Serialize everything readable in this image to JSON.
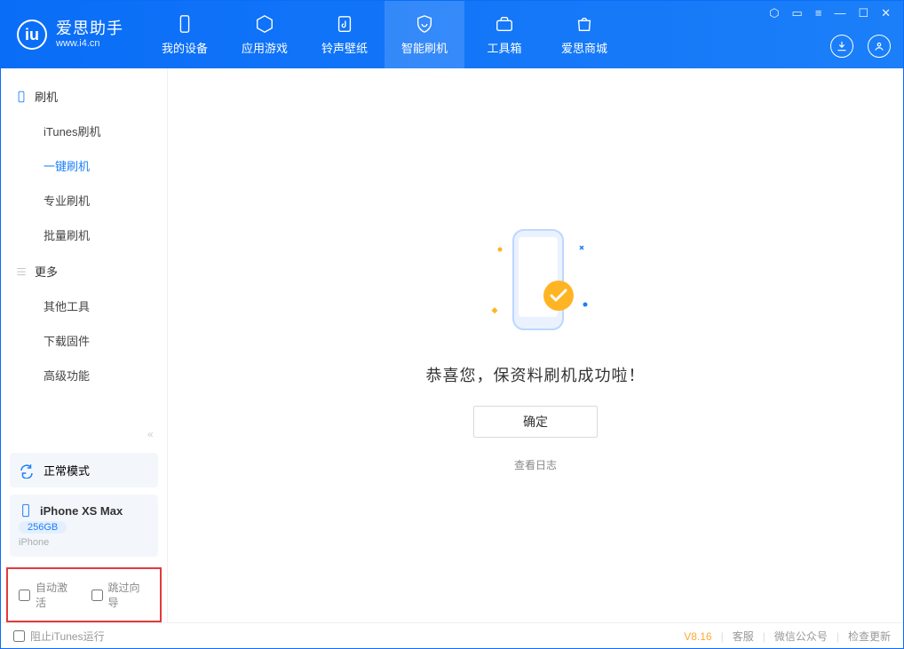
{
  "app": {
    "name": "爱思助手",
    "url": "www.i4.cn"
  },
  "tabs": [
    {
      "label": "我的设备"
    },
    {
      "label": "应用游戏"
    },
    {
      "label": "铃声壁纸"
    },
    {
      "label": "智能刷机"
    },
    {
      "label": "工具箱"
    },
    {
      "label": "爱思商城"
    }
  ],
  "sidebar": {
    "group_flash": "刷机",
    "items_flash": [
      {
        "label": "iTunes刷机"
      },
      {
        "label": "一键刷机"
      },
      {
        "label": "专业刷机"
      },
      {
        "label": "批量刷机"
      }
    ],
    "group_more": "更多",
    "items_more": [
      {
        "label": "其他工具"
      },
      {
        "label": "下载固件"
      },
      {
        "label": "高级功能"
      }
    ],
    "mode_label": "正常模式",
    "device": {
      "name": "iPhone XS Max",
      "capacity": "256GB",
      "type": "iPhone"
    },
    "check_auto_activate": "自动激活",
    "check_skip_guide": "跳过向导"
  },
  "main": {
    "success_text": "恭喜您，保资料刷机成功啦！",
    "ok_label": "确定",
    "log_label": "查看日志"
  },
  "footer": {
    "block_itunes": "阻止iTunes运行",
    "version": "V8.16",
    "support": "客服",
    "wechat": "微信公众号",
    "update": "检查更新"
  },
  "colors": {
    "primary": "#1b7ff9",
    "accent": "#ffb423",
    "text": "#333"
  }
}
